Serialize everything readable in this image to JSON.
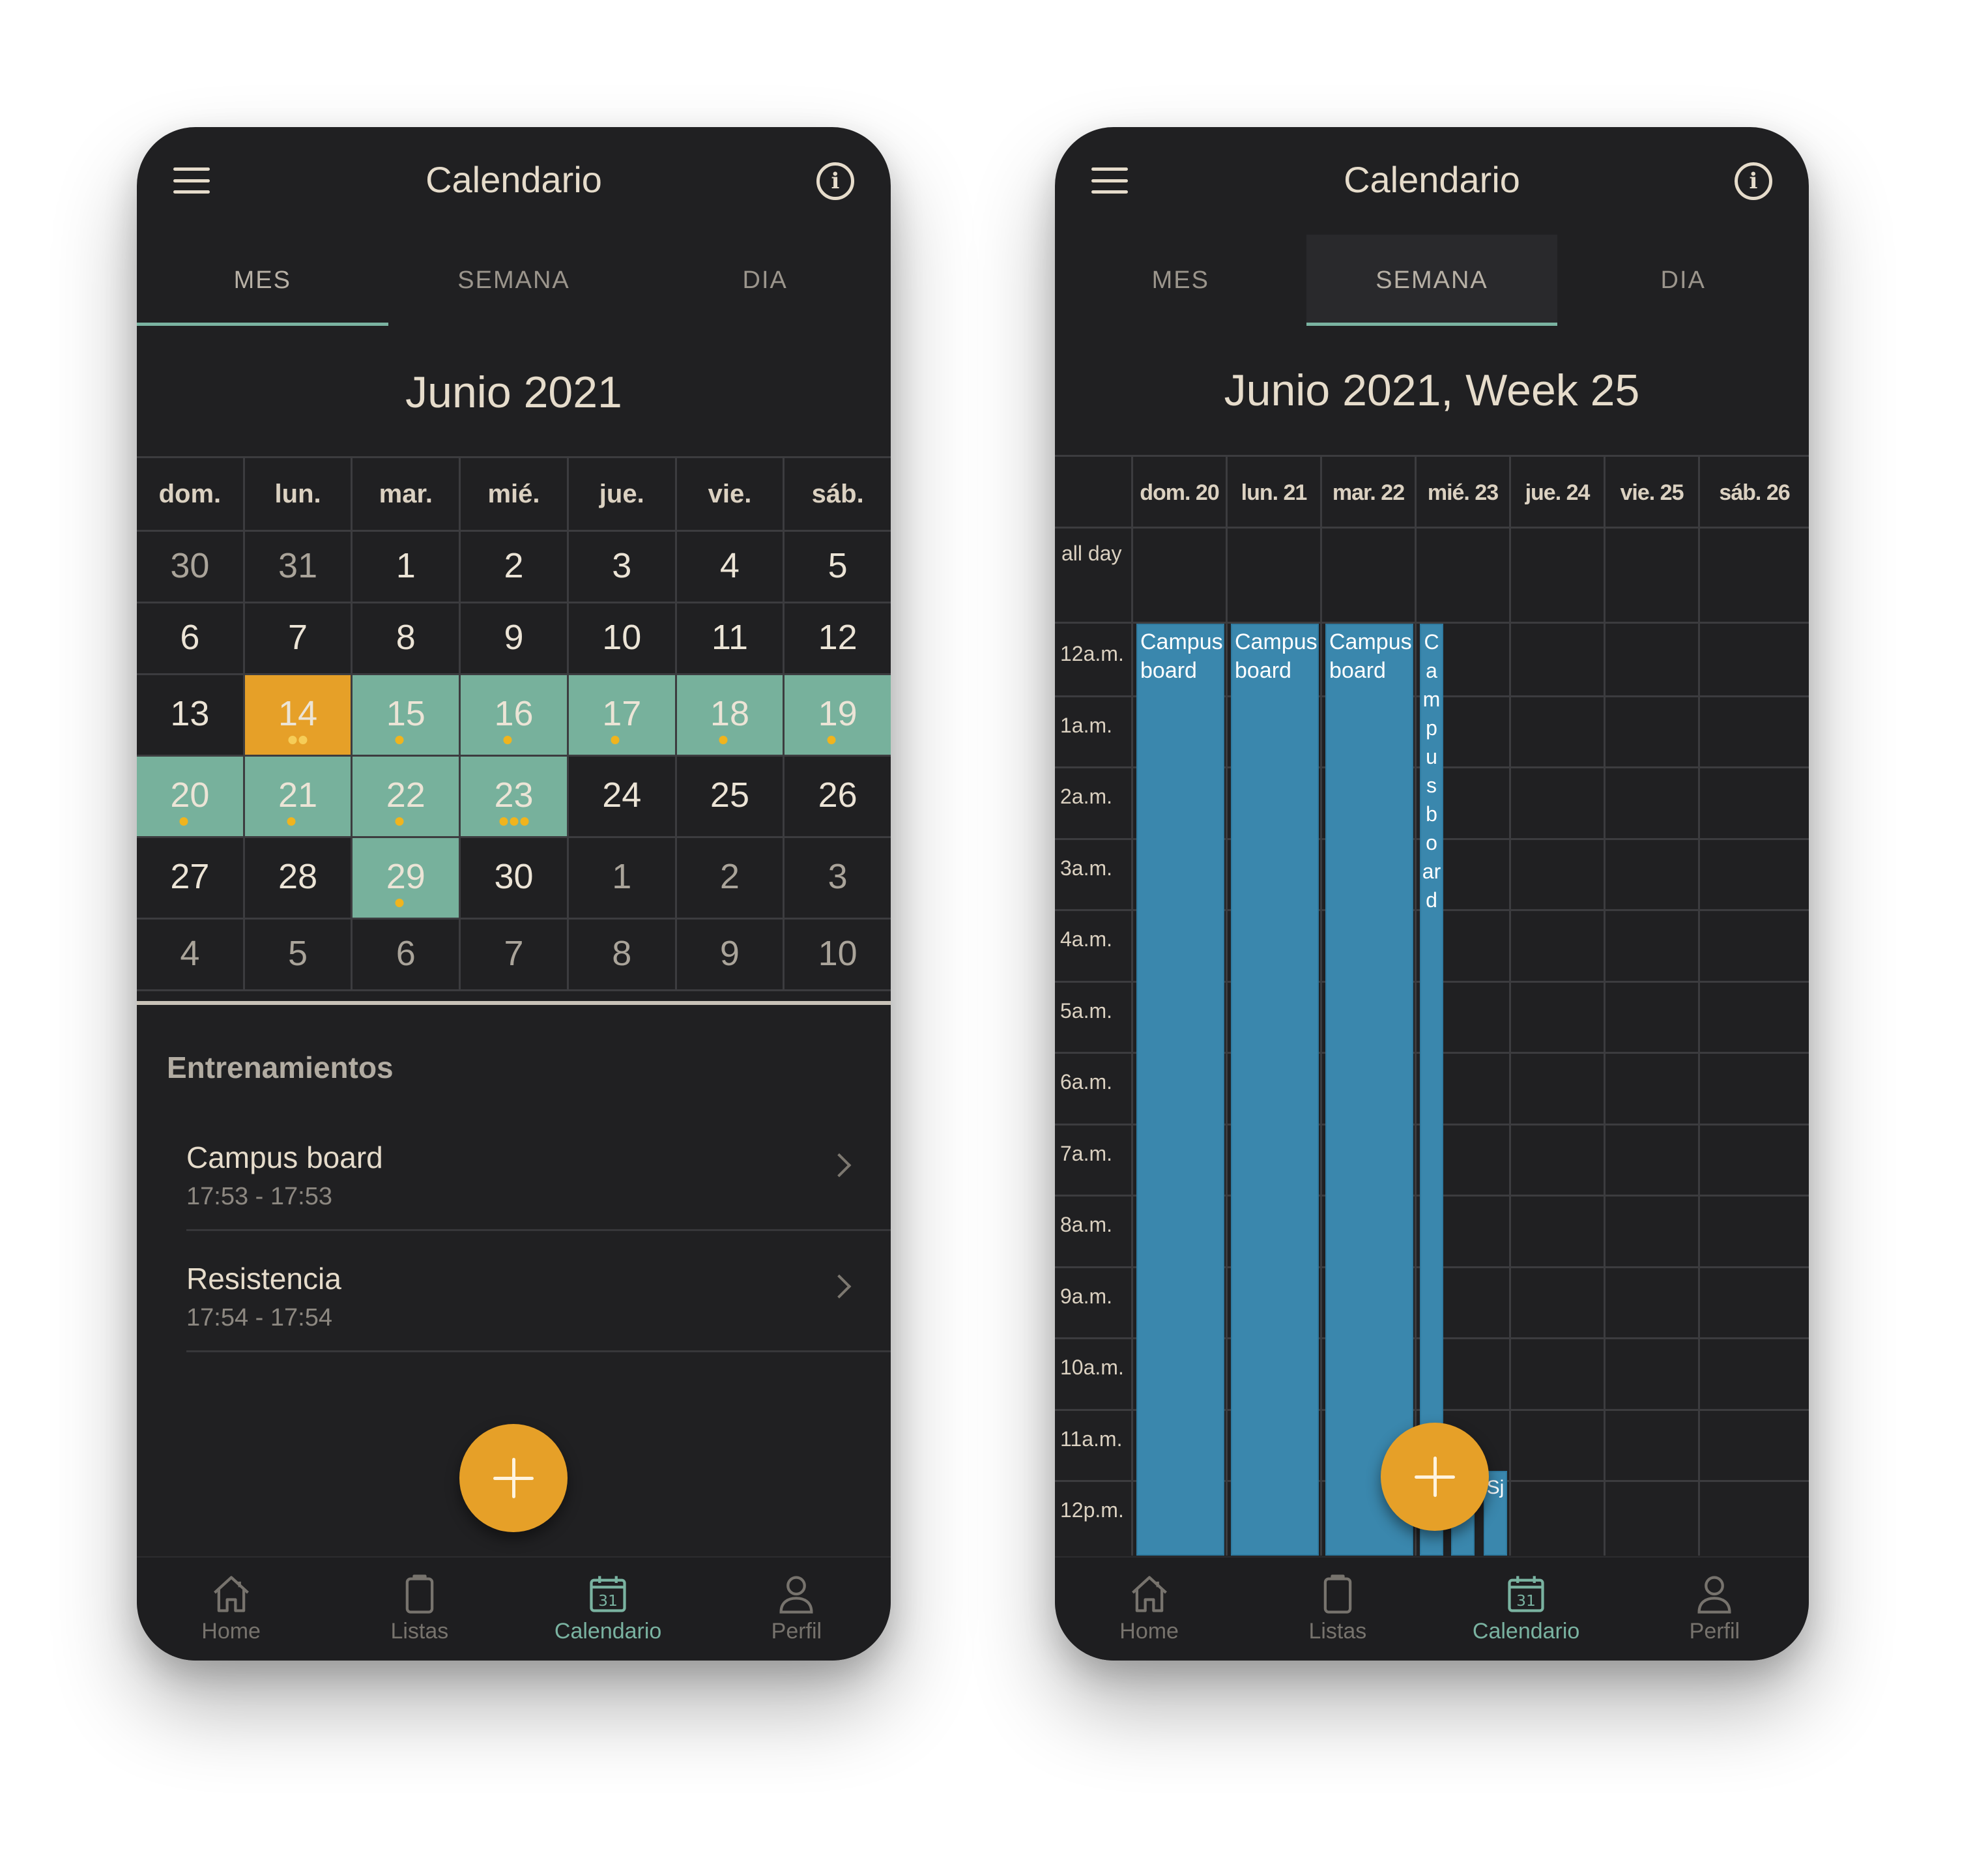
{
  "colors": {
    "phone_bg": "#202022",
    "text_primary": "#e6dccb",
    "accent_teal": "#7ab3a1",
    "event_day": "#77b19c",
    "today": "#e6a028",
    "event_dot": "#f0b41e",
    "week_event": "#3a87ad",
    "fab": "#e6a028"
  },
  "left": {
    "app_title": "Calendario",
    "tabs": [
      {
        "label": "MES",
        "active": true
      },
      {
        "label": "SEMANA",
        "active": false
      },
      {
        "label": "DIA",
        "active": false
      }
    ],
    "month_title": "Junio 2021",
    "weekdays": [
      "dom.",
      "lun.",
      "mar.",
      "mié.",
      "jue.",
      "vie.",
      "sáb."
    ],
    "weeks": [
      [
        {
          "d": "30",
          "other": true
        },
        {
          "d": "31",
          "other": true
        },
        {
          "d": "1"
        },
        {
          "d": "2"
        },
        {
          "d": "3"
        },
        {
          "d": "4"
        },
        {
          "d": "5"
        }
      ],
      [
        {
          "d": "6"
        },
        {
          "d": "7"
        },
        {
          "d": "8"
        },
        {
          "d": "9"
        },
        {
          "d": "10"
        },
        {
          "d": "11"
        },
        {
          "d": "12"
        }
      ],
      [
        {
          "d": "13"
        },
        {
          "d": "14",
          "today": true,
          "dots": 2
        },
        {
          "d": "15",
          "event": true,
          "dots": 1
        },
        {
          "d": "16",
          "event": true,
          "dots": 1
        },
        {
          "d": "17",
          "event": true,
          "dots": 1
        },
        {
          "d": "18",
          "event": true,
          "dots": 1
        },
        {
          "d": "19",
          "event": true,
          "dots": 1
        }
      ],
      [
        {
          "d": "20",
          "event": true,
          "dots": 1
        },
        {
          "d": "21",
          "event": true,
          "dots": 1
        },
        {
          "d": "22",
          "event": true,
          "dots": 1
        },
        {
          "d": "23",
          "event": true,
          "dots": 3
        },
        {
          "d": "24"
        },
        {
          "d": "25"
        },
        {
          "d": "26"
        }
      ],
      [
        {
          "d": "27"
        },
        {
          "d": "28"
        },
        {
          "d": "29",
          "event": true,
          "dots": 1
        },
        {
          "d": "30"
        },
        {
          "d": "1",
          "other": true
        },
        {
          "d": "2",
          "other": true
        },
        {
          "d": "3",
          "other": true
        }
      ],
      [
        {
          "d": "4",
          "other": true
        },
        {
          "d": "5",
          "other": true
        },
        {
          "d": "6",
          "other": true
        },
        {
          "d": "7",
          "other": true
        },
        {
          "d": "8",
          "other": true
        },
        {
          "d": "9",
          "other": true
        },
        {
          "d": "10",
          "other": true
        }
      ]
    ],
    "section_title": "Entrenamientos",
    "events": [
      {
        "name": "Campus board",
        "time": "17:53 - 17:53"
      },
      {
        "name": "Resistencia",
        "time": "17:54 - 17:54"
      }
    ]
  },
  "right": {
    "app_title": "Calendario",
    "tabs": [
      {
        "label": "MES",
        "active": false
      },
      {
        "label": "SEMANA",
        "active": true
      },
      {
        "label": "DIA",
        "active": false
      }
    ],
    "week_title": "Junio 2021, Week 25",
    "day_headers": [
      "dom. 20",
      "lun. 21",
      "mar. 22",
      "mié. 23",
      "jue. 24",
      "vie. 25",
      "sáb. 26"
    ],
    "all_day_label": "all day",
    "hours": [
      "12a.m.",
      "1a.m.",
      "2a.m.",
      "3a.m.",
      "4a.m.",
      "5a.m.",
      "6a.m.",
      "7a.m.",
      "8a.m.",
      "9a.m.",
      "10a.m.",
      "11a.m.",
      "12p.m."
    ],
    "events": [
      {
        "title": "Campus board",
        "day": 0
      },
      {
        "title": "Campus board",
        "day": 1
      },
      {
        "title": "Campus board",
        "day": 2
      },
      {
        "title": "Campus board",
        "day": 3
      }
    ],
    "mini_events": [
      "n",
      "Sj"
    ]
  },
  "nav": [
    {
      "label": "Home",
      "icon": "home-icon",
      "active": false
    },
    {
      "label": "Listas",
      "icon": "clipboard-icon",
      "active": false
    },
    {
      "label": "Calendario",
      "icon": "calendar-icon",
      "active": true,
      "icon_text": "31"
    },
    {
      "label": "Perfil",
      "icon": "person-icon",
      "active": false
    }
  ]
}
